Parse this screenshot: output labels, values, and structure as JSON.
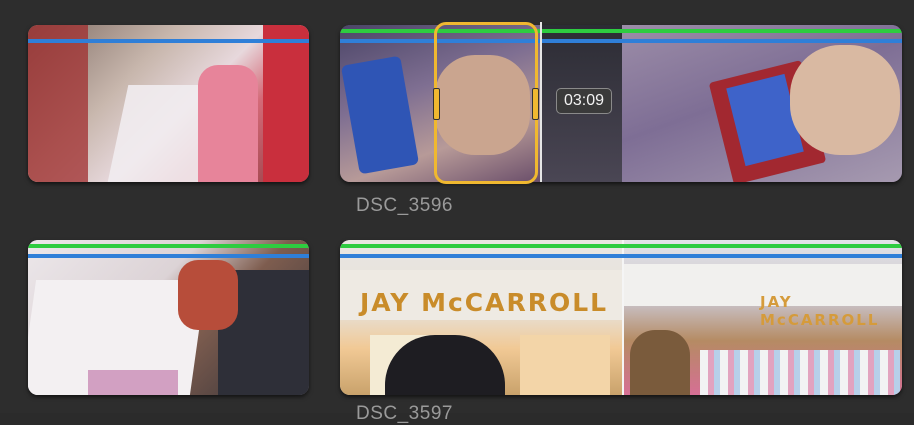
{
  "browser": {
    "clips": [
      {
        "id": "clip-1",
        "name": ""
      },
      {
        "id": "clip-2",
        "name": "DSC_3596",
        "skimmer_timecode": "03:09"
      },
      {
        "id": "clip-3",
        "name": ""
      },
      {
        "id": "clip-4",
        "name": "DSC_3597",
        "banner_text": "JAY McCARROLL",
        "banner_text_2": "JAY McCARROLL"
      }
    ]
  },
  "colors": {
    "background": "#2d2d2d",
    "keyword_bar": "#2ecc40",
    "analysis_bar": "#2f7fd8",
    "skimmer": "#f0b830"
  }
}
